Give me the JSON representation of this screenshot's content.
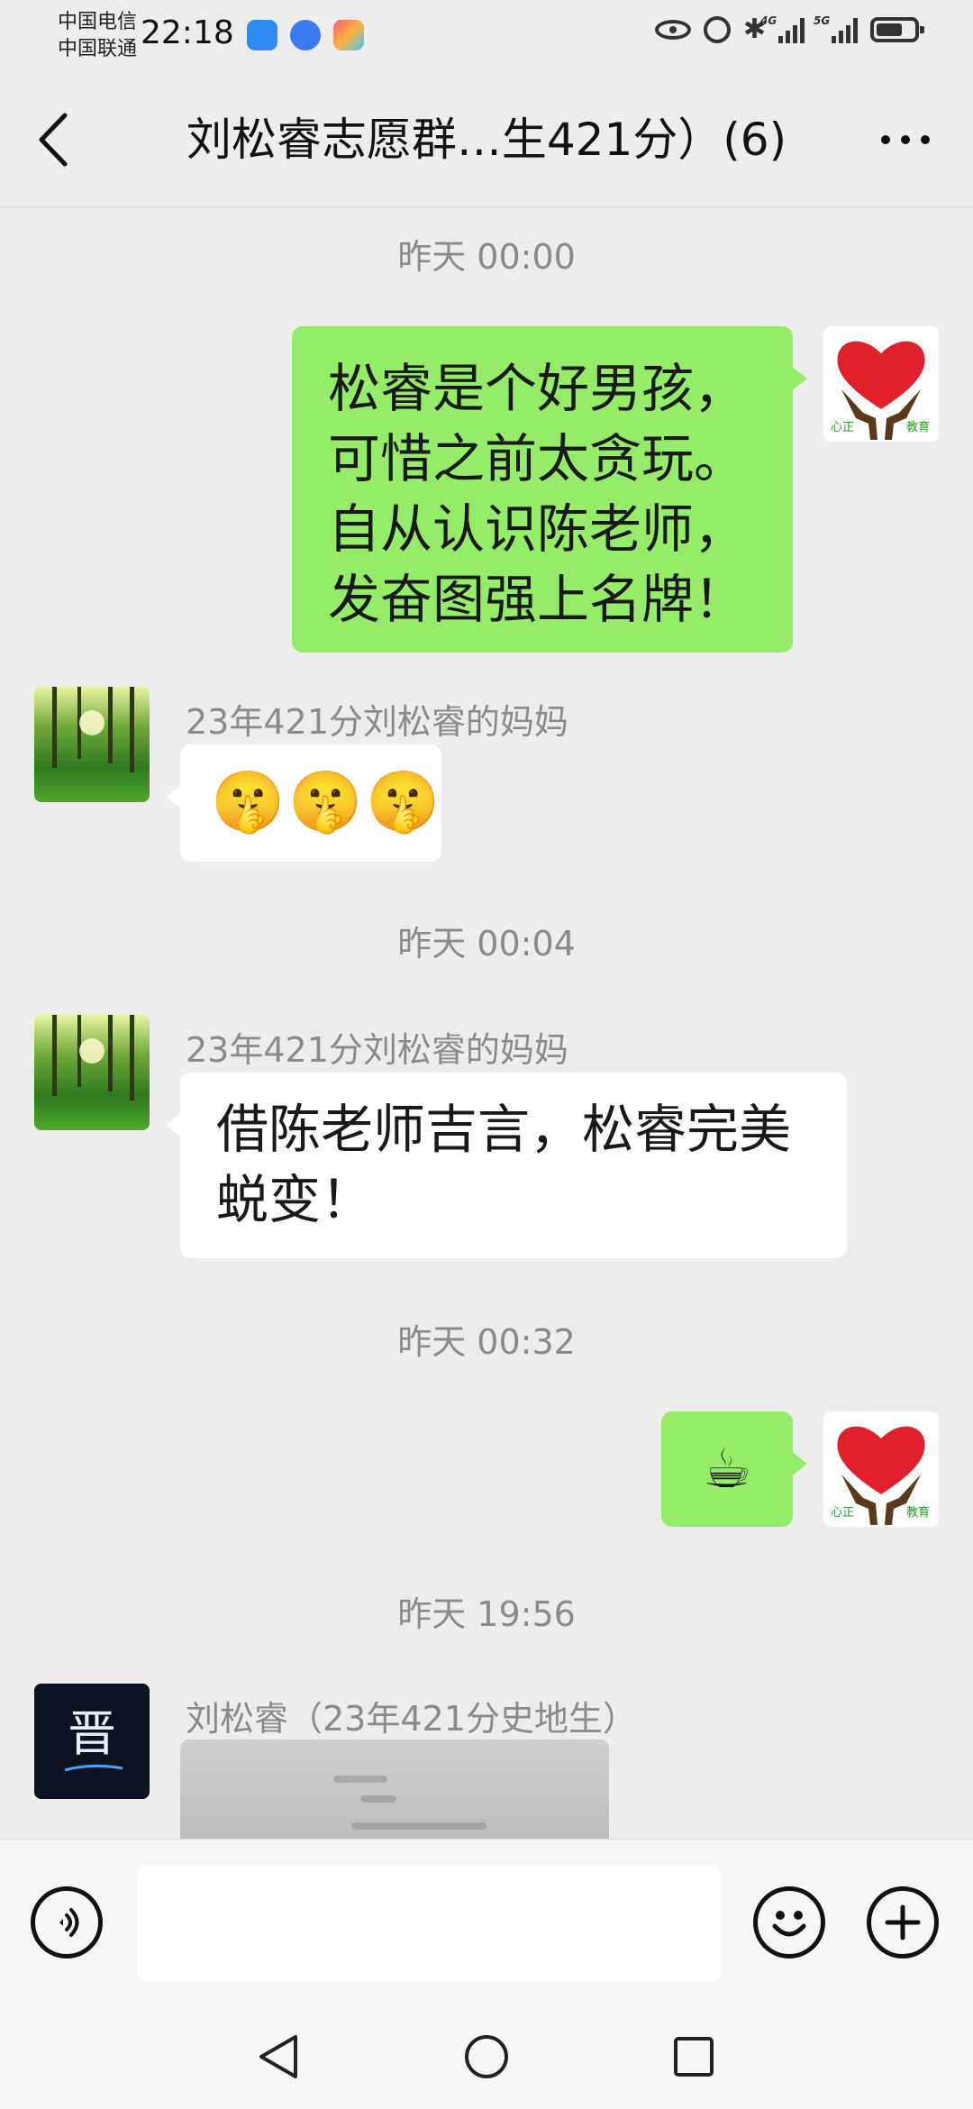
{
  "status_bar": {
    "carrier1": "中国电信",
    "carrier2": "中国联通",
    "time": "22:18",
    "network1": "4G",
    "network2": "5G"
  },
  "header": {
    "title": "刘松睿志愿群…生421分）(6)"
  },
  "messages": [
    {
      "type": "timestamp",
      "text": "昨天 00:00"
    },
    {
      "type": "sent",
      "lines": [
        "松睿是个好男孩，",
        "可惜之前太贪玩。",
        "自从认识陈老师，",
        "发奋图强上名牌！"
      ]
    },
    {
      "type": "received",
      "sender": "23年421分刘松睿的妈妈",
      "emojis": [
        "🤫",
        "🤫",
        "🤫"
      ]
    },
    {
      "type": "timestamp",
      "text": "昨天 00:04"
    },
    {
      "type": "received",
      "sender": "23年421分刘松睿的妈妈",
      "lines": [
        "借陈老师吉言，松睿完美",
        "蜕变！"
      ]
    },
    {
      "type": "timestamp",
      "text": "昨天 00:32"
    },
    {
      "type": "sent",
      "emoji": "☕"
    },
    {
      "type": "timestamp",
      "text": "昨天 19:56"
    },
    {
      "type": "received",
      "sender": "刘松睿（23年421分史地生）",
      "content": "image"
    }
  ],
  "avatars": {
    "self_logo_left": "心正",
    "self_logo_right": "教育",
    "son_logo_char": "晋"
  },
  "input": {
    "value": "",
    "placeholder": ""
  },
  "colors": {
    "sent_bubble": "#95ec69",
    "received_bubble": "#ffffff",
    "background": "#ededed",
    "heart": "#e0202a"
  },
  "icons": [
    "back-arrow-icon",
    "more-dots-icon",
    "voice-icon",
    "emoji-icon",
    "plus-icon",
    "nav-back-icon",
    "nav-home-icon",
    "nav-recents-icon"
  ]
}
